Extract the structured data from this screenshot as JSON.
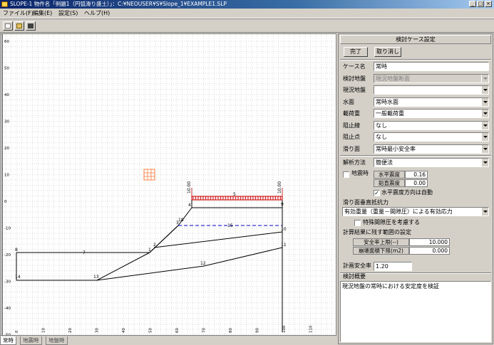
{
  "window": {
    "title": "SLOPE-1 物件名「例題1（円弧滑り盛土）」：C:¥NEOUSER¥S¥Slope_1¥EXAMPLE1.SLP"
  },
  "menu": {
    "items": [
      "ファイル(F)",
      "編集(E)",
      "設定(S)",
      "ヘルプ(H)"
    ]
  },
  "canvas": {
    "y_ticks": [
      "60",
      "50",
      "40",
      "30",
      "20",
      "10",
      "0",
      "-10",
      "-20",
      "-30",
      "-40",
      "-50"
    ],
    "x_ticks": [
      "-10",
      "0",
      "10",
      "20",
      "30",
      "40",
      "50",
      "60",
      "70",
      "80",
      "90",
      "100",
      "110"
    ],
    "node_labels": [
      "1",
      "2",
      "3",
      "4",
      "5",
      "6",
      "7",
      "8",
      "9",
      "10",
      "11",
      "12",
      "13",
      "14",
      "15",
      "16",
      "17",
      "18"
    ],
    "load_label": "10.00",
    "load_label_right": "10.00"
  },
  "bottom_tabs": [
    "常時",
    "地震時",
    "地盤時"
  ],
  "panel": {
    "header": "検討ケース設定",
    "ok_button": "完了",
    "cancel_button": "取り消し",
    "fields": [
      {
        "label": "ケース名",
        "value": "常時",
        "type": "text",
        "disabled": false
      },
      {
        "label": "検討地盤",
        "value": "現況地盤断面",
        "type": "select",
        "disabled": true
      },
      {
        "label": "現況地盤",
        "value": "",
        "type": "select",
        "disabled": false
      },
      {
        "label": "水面",
        "value": "常時水面",
        "type": "select",
        "disabled": false
      },
      {
        "label": "載荷重",
        "value": "一般載荷重",
        "type": "select",
        "disabled": false
      },
      {
        "label": "阻止線",
        "value": "なし",
        "type": "select",
        "disabled": false
      },
      {
        "label": "阻止点",
        "value": "なし",
        "type": "select",
        "disabled": false
      },
      {
        "label": "滑り面",
        "value": "常時最小安全率",
        "type": "select",
        "disabled": false
      }
    ],
    "analysis_method_label": "解析方法",
    "analysis_method_value": "簡便法",
    "seismic_checkbox_label": "地震時",
    "seismic_checked": false,
    "kh_label": "水平震度",
    "kh_value": "0.16",
    "kv_label": "鉛直震度",
    "kv_value": "0.00",
    "auto_dir_label": "水平震度方向は自動",
    "auto_dir_checked": true,
    "shear_resistance_label": "滑り面垂直抵抗力",
    "shear_resistance_value": "有効重量（重量－間隙圧）による有効応力",
    "special_pore_label": "特殊間隙圧を考慮する",
    "special_pore_checked": false,
    "result_range_label": "計算結果に残す範囲の設定",
    "fs_upper_label": "安全率上限(--)",
    "fs_upper_value": "10.000",
    "area_lower_label": "崩壊面積下限(m2)",
    "area_lower_value": "0.000",
    "design_fs_label": "計画安全率",
    "design_fs_value": "1.20",
    "memo_label": "検討概要",
    "memo_text": "現況地盤の常時における安定度を検証"
  },
  "colors": {
    "title_start": "#0a246a",
    "title_end": "#a6caf0",
    "load_color": "#c00000",
    "water_color": "#0000c0",
    "orange_grid": "#ff8040"
  }
}
